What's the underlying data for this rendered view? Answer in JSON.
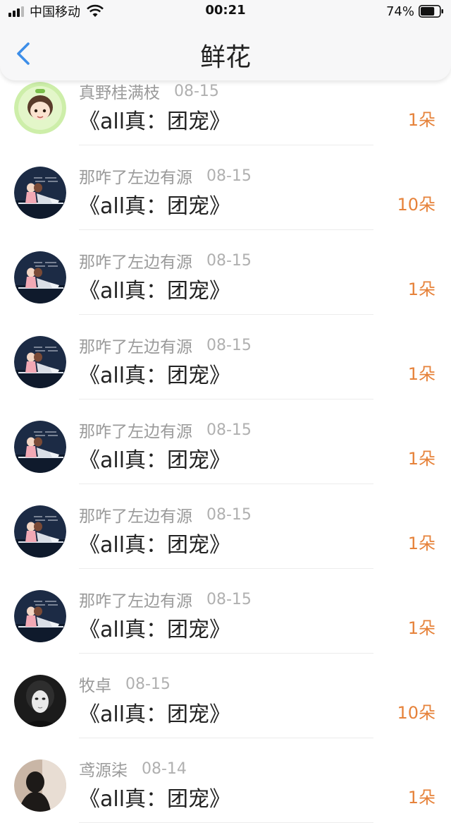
{
  "status_bar": {
    "carrier": "中国移动",
    "time": "00:21",
    "battery": "74%",
    "battery_level": 0.74
  },
  "nav": {
    "title": "鲜花"
  },
  "items": [
    {
      "name": "真野桂满枝",
      "date": "08-15",
      "book": "《all真：团宠》",
      "flowers": "1朵",
      "avatar": "cartoon-boy-avatar"
    },
    {
      "name": "那咋了左边有源",
      "date": "08-15",
      "book": "《all真：团宠》",
      "flowers": "10朵",
      "avatar": "anime-couple-avatar"
    },
    {
      "name": "那咋了左边有源",
      "date": "08-15",
      "book": "《all真：团宠》",
      "flowers": "1朵",
      "avatar": "anime-couple-avatar"
    },
    {
      "name": "那咋了左边有源",
      "date": "08-15",
      "book": "《all真：团宠》",
      "flowers": "1朵",
      "avatar": "anime-couple-avatar"
    },
    {
      "name": "那咋了左边有源",
      "date": "08-15",
      "book": "《all真：团宠》",
      "flowers": "1朵",
      "avatar": "anime-couple-avatar"
    },
    {
      "name": "那咋了左边有源",
      "date": "08-15",
      "book": "《all真：团宠》",
      "flowers": "1朵",
      "avatar": "anime-couple-avatar"
    },
    {
      "name": "那咋了左边有源",
      "date": "08-15",
      "book": "《all真：团宠》",
      "flowers": "1朵",
      "avatar": "anime-couple-avatar"
    },
    {
      "name": "牧卓",
      "date": "08-15",
      "book": "《all真：团宠》",
      "flowers": "10朵",
      "avatar": "masked-person-avatar"
    },
    {
      "name": "鸢源柒",
      "date": "08-14",
      "book": "《all真：团宠》",
      "flowers": "1朵",
      "avatar": "silhouette-avatar"
    }
  ]
}
